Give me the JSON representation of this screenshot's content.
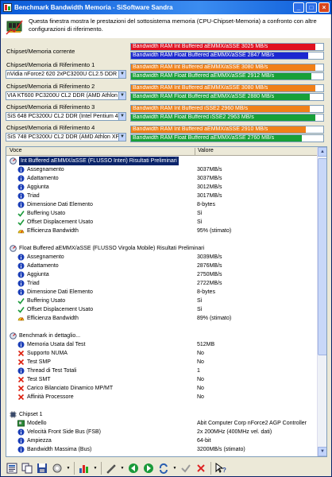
{
  "window": {
    "title": "Benchmark Bandwidth Memoria - SiSoftware Sandra"
  },
  "info": {
    "text": "Questa finestra mostra le prestazioni del sottosistema memoria (CPU-Chipset-Memoria) a confronto con altre configurazioni di riferimento."
  },
  "comparison": {
    "current_label": "Chipset/Memoria corrente",
    "refs": [
      {
        "label": "Chipset/Memoria di Riferimento 1",
        "value": "nVidia nForce2 620 2xPC3200U CL2.5 DDR (",
        "bars": [
          {
            "text": "Bandwidth RAM Int Buffered aEMMX/aSSE 3080 MB/s",
            "pct": 96,
            "color": "#f08018"
          },
          {
            "text": "Bandwidth RAM Float Buffered aEMMX/aSSE 2912 MB/s",
            "pct": 94,
            "color": "#18a038"
          }
        ]
      },
      {
        "label": "Chipset/Memoria di Riferimento 2",
        "value": "VIA KT600 PC3200U CL2 DDR (AMD Athlon X",
        "bars": [
          {
            "text": "Bandwidth RAM Int Buffered aEMMX/aSSE 3080 MB/s",
            "pct": 96,
            "color": "#f08018"
          },
          {
            "text": "Bandwidth RAM Float Buffered aEMMX/aSSE 2880 MB/s",
            "pct": 93,
            "color": "#18a038"
          }
        ]
      },
      {
        "label": "Chipset/Memoria di Riferimento 3",
        "value": "SiS 648 PC3200U CL2 DDR (Intel Pentium 4-",
        "bars": [
          {
            "text": "Bandwidth RAM Int Buffered iSSE2 2960 MB/s",
            "pct": 93,
            "color": "#f08018"
          },
          {
            "text": "Bandwidth RAM Float Buffered iSSE2 2963 MB/s",
            "pct": 96,
            "color": "#18a038"
          }
        ]
      },
      {
        "label": "Chipset/Memoria di Riferimento 4",
        "value": "SiS 748 PC3200U CL2 DDR (AMD Athlon XP/",
        "bars": [
          {
            "text": "Bandwidth RAM Int Buffered aEMMX/aSSE 2910 MB/s",
            "pct": 91,
            "color": "#f08018"
          },
          {
            "text": "Bandwidth RAM Float Buffered aEMMX/aSSE 2760 MB/s",
            "pct": 89,
            "color": "#18a038"
          }
        ]
      }
    ],
    "current_bars": [
      {
        "text": "Bandwidth RAM Int Buffered aEMMX/aSSE 3025 MB/s",
        "pct": 96,
        "color": "#e01020"
      },
      {
        "text": "Bandwidth RAM Float Buffered aEMMX/aSSE 2847 MB/s",
        "pct": 92,
        "color": "#1c28d0"
      }
    ]
  },
  "list": {
    "col_voce": "Voce",
    "col_valore": "Valore",
    "rows": [
      {
        "lvl": 0,
        "icon": "benchmark",
        "label": "Int Buffered aEMMX/aSSE (FLUSSO Interi) Risultati Preliminari",
        "value": "",
        "selected": true
      },
      {
        "lvl": 1,
        "icon": "info",
        "label": "Assegnamento",
        "value": "3037MB/s"
      },
      {
        "lvl": 1,
        "icon": "info",
        "label": "Adattamento",
        "value": "3037MB/s"
      },
      {
        "lvl": 1,
        "icon": "info",
        "label": "Aggiunta",
        "value": "3012MB/s"
      },
      {
        "lvl": 1,
        "icon": "info",
        "label": "Triad",
        "value": "3017MB/s"
      },
      {
        "lvl": 1,
        "icon": "info",
        "label": "Dimensione Dati Elemento",
        "value": "8-bytes"
      },
      {
        "lvl": 1,
        "icon": "check",
        "label": "Buffering Usato",
        "value": "Sì"
      },
      {
        "lvl": 1,
        "icon": "check",
        "label": "Offset Displacement Usato",
        "value": "Sì"
      },
      {
        "lvl": 1,
        "icon": "gauge",
        "label": "Efficienza Bandwidth",
        "value": "95% (stimato)"
      },
      {
        "lvl": 0,
        "icon": "none",
        "label": "",
        "value": ""
      },
      {
        "lvl": 0,
        "icon": "benchmark",
        "label": "Float Buffered aEMMX/aSSE (FLUSSO Virgola Mobile) Risultati Preliminari",
        "value": ""
      },
      {
        "lvl": 1,
        "icon": "info",
        "label": "Assegnamento",
        "value": "3039MB/s"
      },
      {
        "lvl": 1,
        "icon": "info",
        "label": "Adattamento",
        "value": "2876MB/s"
      },
      {
        "lvl": 1,
        "icon": "info",
        "label": "Aggiunta",
        "value": "2750MB/s"
      },
      {
        "lvl": 1,
        "icon": "info",
        "label": "Triad",
        "value": "2722MB/s"
      },
      {
        "lvl": 1,
        "icon": "info",
        "label": "Dimensione Dati Elemento",
        "value": "8-bytes"
      },
      {
        "lvl": 1,
        "icon": "check",
        "label": "Buffering Usato",
        "value": "Sì"
      },
      {
        "lvl": 1,
        "icon": "check",
        "label": "Offset Displacement Usato",
        "value": "Sì"
      },
      {
        "lvl": 1,
        "icon": "gauge",
        "label": "Efficienza Bandwidth",
        "value": "89% (stimato)"
      },
      {
        "lvl": 0,
        "icon": "none",
        "label": "",
        "value": ""
      },
      {
        "lvl": 0,
        "icon": "benchmark",
        "label": "Benchmark in dettaglio...",
        "value": ""
      },
      {
        "lvl": 1,
        "icon": "info",
        "label": "Memoria Usata dal Test",
        "value": "512MB"
      },
      {
        "lvl": 1,
        "icon": "cross",
        "label": "Supporto NUMA",
        "value": "No"
      },
      {
        "lvl": 1,
        "icon": "cross",
        "label": "Test SMP",
        "value": "No"
      },
      {
        "lvl": 1,
        "icon": "info",
        "label": "Thread di Test Totali",
        "value": "1"
      },
      {
        "lvl": 1,
        "icon": "cross",
        "label": "Test SMT",
        "value": "No"
      },
      {
        "lvl": 1,
        "icon": "cross",
        "label": "Carico Bilanciato Dinamico MP/MT",
        "value": "No"
      },
      {
        "lvl": 1,
        "icon": "cross",
        "label": "Affinità Processore",
        "value": "No"
      },
      {
        "lvl": 0,
        "icon": "none",
        "label": "",
        "value": ""
      },
      {
        "lvl": 0,
        "icon": "chipset",
        "label": "Chipset 1",
        "value": ""
      },
      {
        "lvl": 1,
        "icon": "board",
        "label": "Modello",
        "value": "Abit Computer Corp nForce2 AGP Controller"
      },
      {
        "lvl": 1,
        "icon": "info",
        "label": "Velocità Front Side Bus (FSB)",
        "value": "2x 200MHz (400MHz vel. dati)"
      },
      {
        "lvl": 1,
        "icon": "info",
        "label": "Ampiezza",
        "value": "64-bit"
      },
      {
        "lvl": 1,
        "icon": "info",
        "label": "Bandwidth Massima (Bus)",
        "value": "3200MB/s (stimato)"
      }
    ]
  }
}
